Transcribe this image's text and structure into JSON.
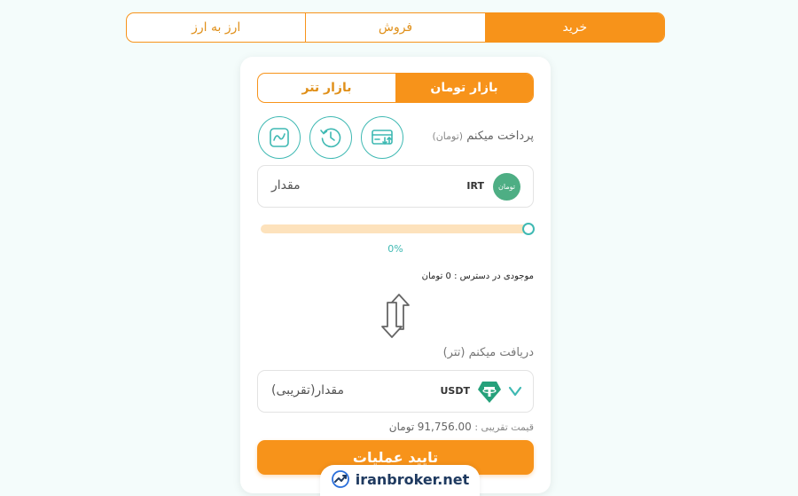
{
  "top_tabs": {
    "buy": "خرید",
    "sell": "فروش",
    "currency_to_currency": "ارز به ارز"
  },
  "market_tabs": {
    "toman_market": "بازار تومان",
    "tether_market": "بازار تتر"
  },
  "pay": {
    "label": "پرداخت میکنم",
    "unit": "(تومان)",
    "placeholder": "مقدار",
    "currency_code": "IRT",
    "coin_text": "تومان"
  },
  "slider": {
    "percent_label": "0%",
    "value": 0
  },
  "balance": {
    "label": "موجودی در دسترس : 0 تومان"
  },
  "receive": {
    "label": "دریافت میکنم (تتر)",
    "placeholder": "مقدار(تقریبی)",
    "currency_code": "USDT"
  },
  "approx_price": {
    "label": "قیمت تقریبی :",
    "value": "91,756.00",
    "unit": "تومان"
  },
  "submit_label": "تایید عملیات",
  "brand": {
    "name": "iranbroker.net"
  },
  "colors": {
    "accent": "#f7931a",
    "teal": "#3fb9b3",
    "tether": "#26a17b"
  }
}
